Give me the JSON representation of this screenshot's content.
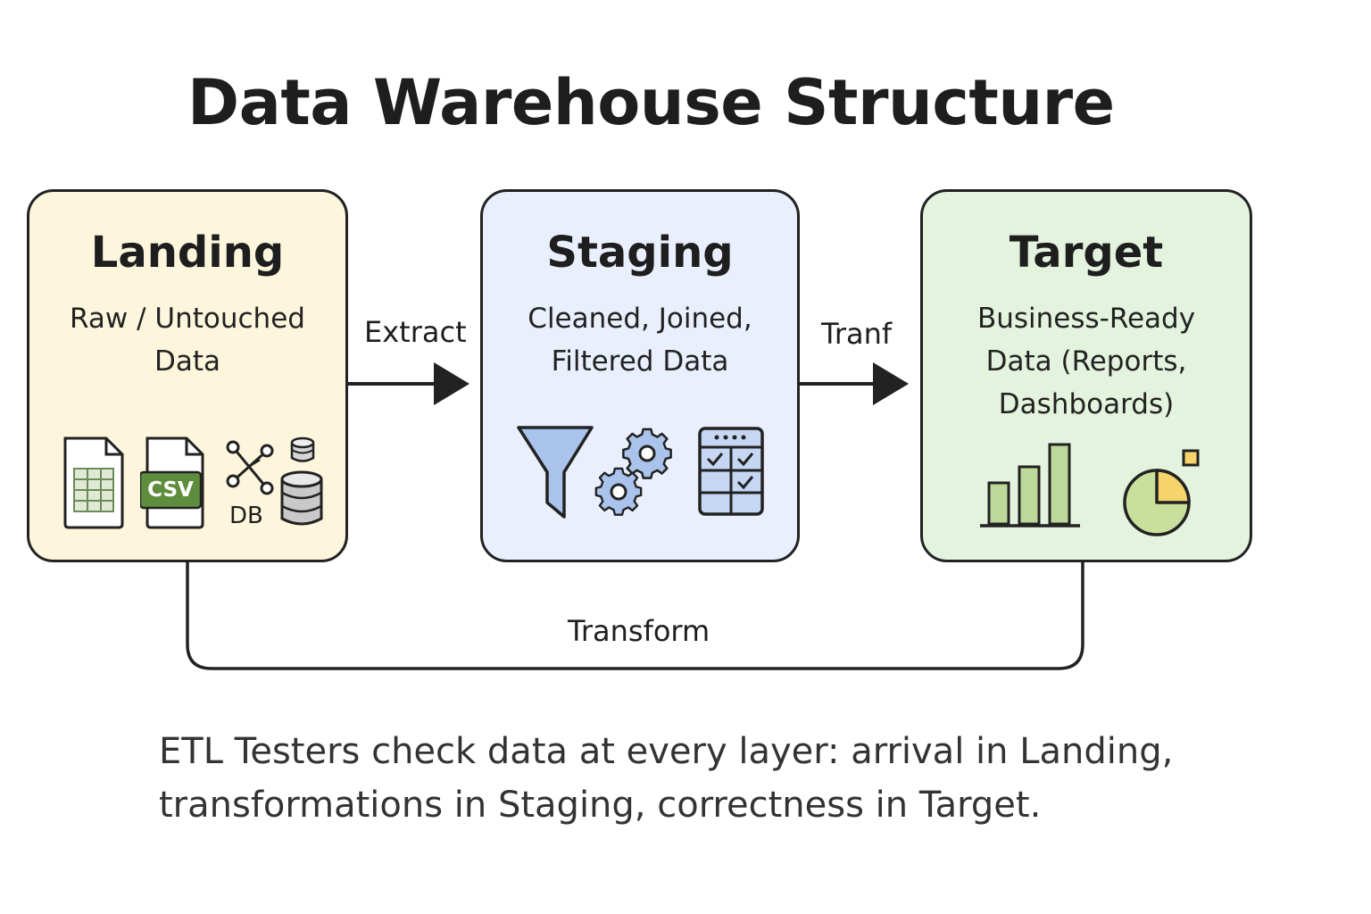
{
  "title": "Data Warehouse Structure",
  "layers": {
    "landing": {
      "name": "Landing",
      "description": "Raw / Untouched\nData",
      "db_label": "DB",
      "csv_label": "CSV",
      "color": "#fdf6dd"
    },
    "staging": {
      "name": "Staging",
      "description": "Cleaned, Joined,\nFiltered Data",
      "color": "#e9effc"
    },
    "target": {
      "name": "Target",
      "description": "Business-Ready\nData (Reports,\nDashboards)",
      "color": "#e3f3de"
    }
  },
  "arrows": {
    "extract": "Extract",
    "tranf": "Tranf",
    "transform": "Transform"
  },
  "note": "ETL Testers check data at every layer: arrival in Landing,\ntransformations in Staging, correctness in Target."
}
